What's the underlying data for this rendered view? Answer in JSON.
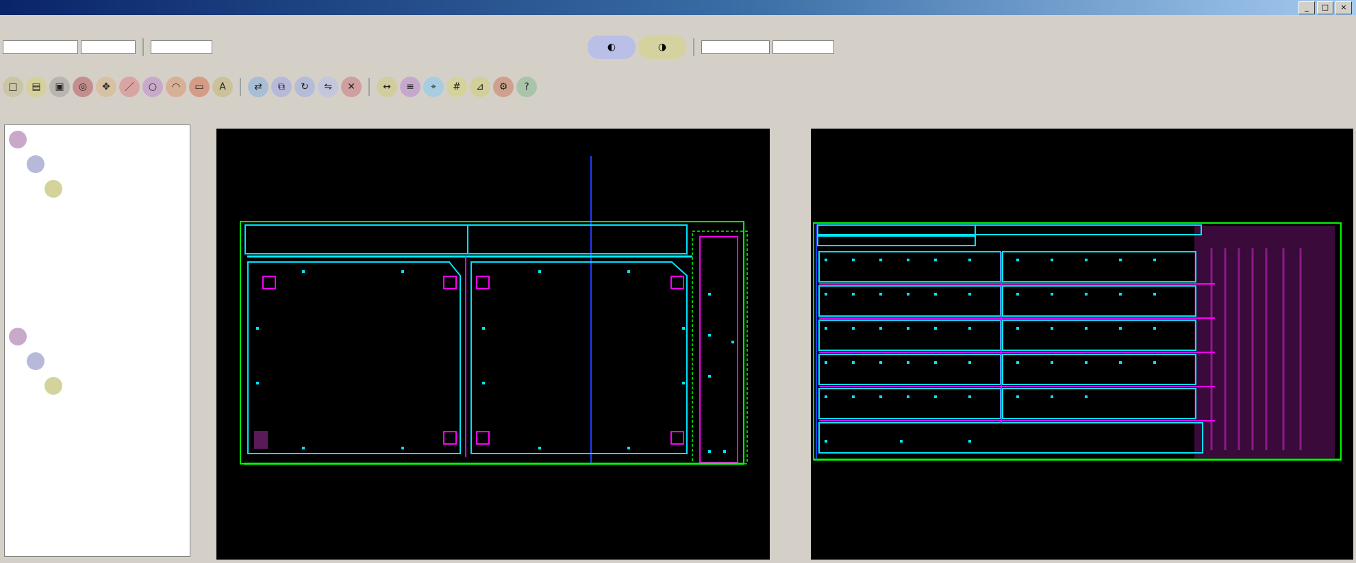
{
  "window": {
    "title": "",
    "buttons": [
      "_",
      "□",
      "×"
    ]
  },
  "menubar": [
    "",
    "",
    "",
    "",
    "",
    "",
    "",
    "",
    "",
    ""
  ],
  "toolbar1": {
    "combo_a": "",
    "combo_b": "",
    "items": [
      "",
      "",
      ""
    ]
  },
  "toolbar2": {
    "items": [
      "",
      "",
      "",
      "",
      "",
      "",
      "",
      "",
      "",
      "",
      "",
      "",
      "",
      "",
      "",
      "",
      "",
      "",
      "",
      "",
      "",
      "",
      "",
      ""
    ]
  },
  "left_panel": {
    "header": "",
    "tree": [
      {
        "label": "",
        "level": 0
      },
      {
        "label": "",
        "level": 1
      },
      {
        "label": "",
        "level": 2
      },
      {
        "label": "",
        "level": 3
      },
      {
        "label": "",
        "level": 3
      },
      {
        "label": "",
        "level": 3
      },
      {
        "label": "",
        "level": 3
      },
      {
        "label": "",
        "level": 3
      },
      {
        "label": "",
        "level": 0
      },
      {
        "label": "",
        "level": 1
      },
      {
        "label": "",
        "level": 2
      },
      {
        "label": "",
        "level": 3
      },
      {
        "label": "",
        "level": 3
      },
      {
        "label": "",
        "level": 3
      },
      {
        "label": "",
        "level": 3
      },
      {
        "label": "",
        "level": 3
      }
    ]
  },
  "viewports": {
    "left": {
      "status": "",
      "coords": ""
    },
    "right": {
      "status": "",
      "coords": ""
    }
  },
  "colors": {
    "outline_green": "#00ff00",
    "panel_cyan": "#00e5ff",
    "cutout_magenta": "#ff00ff",
    "axis_blue": "#1e3cff",
    "grid_purple": "#8a1a8a"
  }
}
